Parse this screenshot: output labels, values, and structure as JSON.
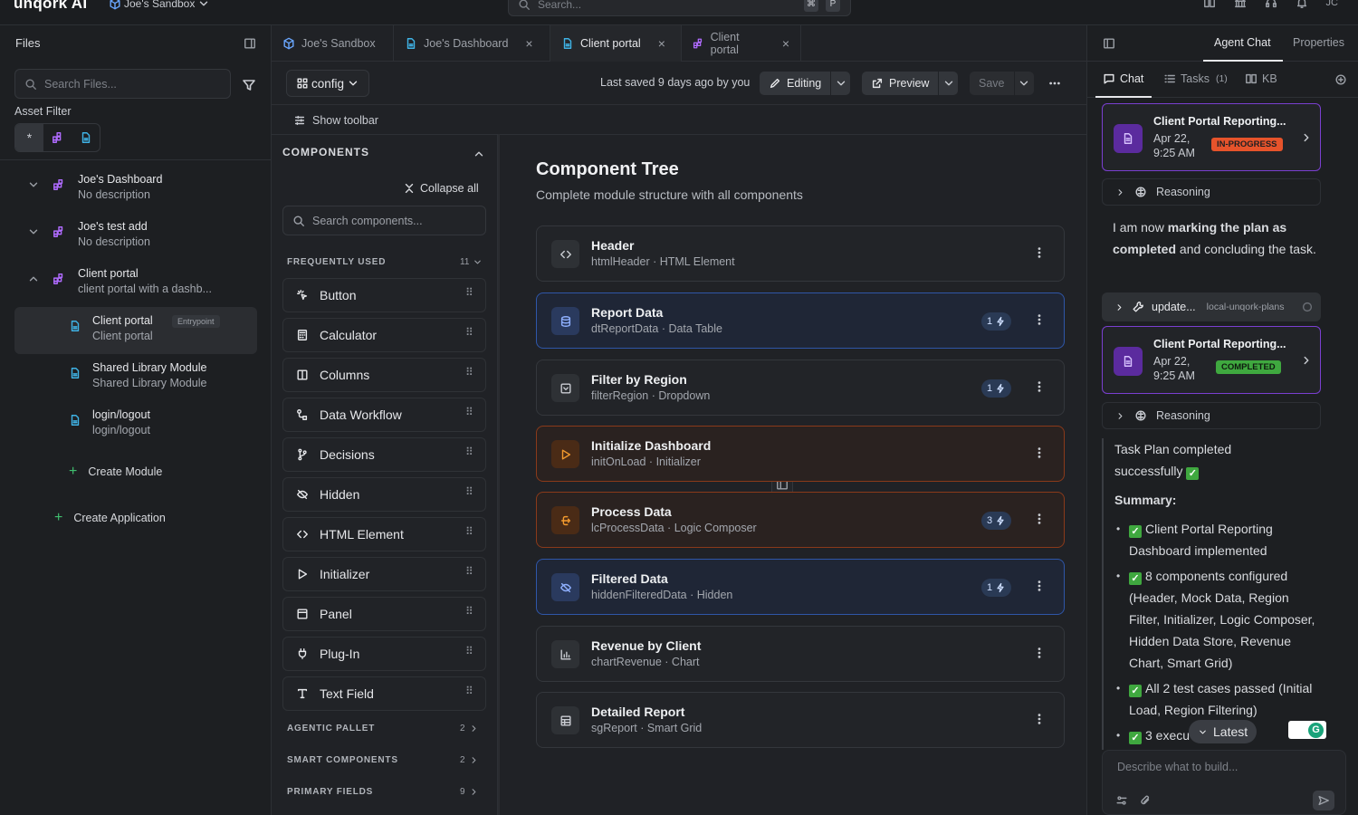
{
  "app": {
    "logo": "unqork AI",
    "sandbox_label": "Joe's Sandbox",
    "search_placeholder": "Search...",
    "kbd1": "⌘",
    "kbd2": "P",
    "avatar": "JC"
  },
  "files": {
    "title": "Files",
    "search_placeholder": "Search Files...",
    "asset_filter_label": "Asset Filter",
    "asset_filter_all": "*",
    "items": [
      {
        "title": "Joe's Dashboard",
        "subtitle": "No description"
      },
      {
        "title": "Joe's test add",
        "subtitle": "No description"
      },
      {
        "title": "Client portal",
        "subtitle": "client portal with a dashb..."
      }
    ],
    "modules": [
      {
        "title": "Client portal",
        "subtitle": "Client portal",
        "badge": "Entrypoint"
      },
      {
        "title": "Shared Library Module",
        "subtitle": "Shared Library Module"
      },
      {
        "title": "login/logout",
        "subtitle": "login/logout"
      }
    ],
    "create_module": "Create Module",
    "create_application": "Create Application"
  },
  "tabs": [
    {
      "label": "Joe's Sandbox"
    },
    {
      "label": "Joe's Dashboard"
    },
    {
      "label": "Client portal"
    },
    {
      "label": "Client portal"
    }
  ],
  "toolbar": {
    "config_label": "config",
    "last_saved": "Last saved 9 days ago by you",
    "editing": "Editing",
    "preview": "Preview",
    "save": "Save",
    "show_toolbar": "Show toolbar"
  },
  "components": {
    "title": "COMPONENTS",
    "collapse_all": "Collapse all",
    "search_placeholder": "Search components...",
    "frequently_used": "FREQUENTLY USED",
    "frequently_used_count": "11",
    "items": [
      "Button",
      "Calculator",
      "Columns",
      "Data Workflow",
      "Decisions",
      "Hidden",
      "HTML Element",
      "Initializer",
      "Panel",
      "Plug-In",
      "Text Field"
    ],
    "sections": [
      {
        "label": "AGENTIC PALLET",
        "count": "2"
      },
      {
        "label": "SMART COMPONENTS",
        "count": "2"
      },
      {
        "label": "PRIMARY FIELDS",
        "count": "9"
      }
    ]
  },
  "component_tree": {
    "title": "Component Tree",
    "subtitle": "Complete module structure with all components",
    "cards": [
      {
        "title": "Header",
        "subtitle": "htmlHeader · HTML Element",
        "icon": "code-icon",
        "style": "default",
        "count": ""
      },
      {
        "title": "Report Data",
        "subtitle": "dtReportData · Data Table",
        "icon": "database-icon",
        "style": "blue",
        "count": "1"
      },
      {
        "title": "Filter by Region",
        "subtitle": "filterRegion · Dropdown",
        "icon": "dropdown-icon",
        "style": "default",
        "count": "1"
      },
      {
        "title": "Initialize Dashboard",
        "subtitle": "initOnLoad · Initializer",
        "icon": "play-icon",
        "style": "orange",
        "count": ""
      },
      {
        "title": "Process Data",
        "subtitle": "lcProcessData · Logic Composer",
        "icon": "logic-icon",
        "style": "orange",
        "count": "3"
      },
      {
        "title": "Filtered Data",
        "subtitle": "hiddenFilteredData · Hidden",
        "icon": "eye-off-icon",
        "style": "blue",
        "count": "1"
      },
      {
        "title": "Revenue by Client",
        "subtitle": "chartRevenue · Chart",
        "icon": "chart-icon",
        "style": "default",
        "count": ""
      },
      {
        "title": "Detailed Report",
        "subtitle": "sgReport · Smart Grid",
        "icon": "grid-icon",
        "style": "default",
        "count": ""
      }
    ]
  },
  "agent": {
    "tab_agent_chat": "Agent Chat",
    "tab_properties": "Properties",
    "subtab_chat": "Chat",
    "subtab_tasks": "Tasks",
    "tasks_count": "(1)",
    "subtab_kb": "KB",
    "task1": {
      "title": "Client Portal Reporting...",
      "date": "Apr 22, 9:25 AM",
      "status": "IN-PROGRESS"
    },
    "reasoning_label": "Reasoning",
    "message1_a": "I am now ",
    "message1_b": "marking the plan as completed",
    "message1_c": " and concluding the task.",
    "tool_name": "update...",
    "tool_server": "local-unqork-plans",
    "task2": {
      "title": "Client Portal Reporting...",
      "date": "Apr 22, 9:25 AM",
      "status": "COMPLETED"
    },
    "summary_intro": "Task Plan completed successfully",
    "summary_heading": "Summary:",
    "bullets": [
      "Client Portal Reporting Dashboard implemented",
      "8 components configured (Header, Mock Data, Region Filter, Initializer, Logic Composer, Hidden Data Store, Revenue Chart, Smart Grid)",
      "All 2 test cases passed (Initial Load, Region Filtering)",
      "3 execu"
    ],
    "latest_label": "Latest",
    "composer_placeholder": "Describe what to build..."
  },
  "colors": {
    "accent_blue": "#2f56a8",
    "accent_orange": "#8a3a1a",
    "purple": "#7a3fd0",
    "in_progress": "#e6532b",
    "completed": "#3fa83f"
  }
}
